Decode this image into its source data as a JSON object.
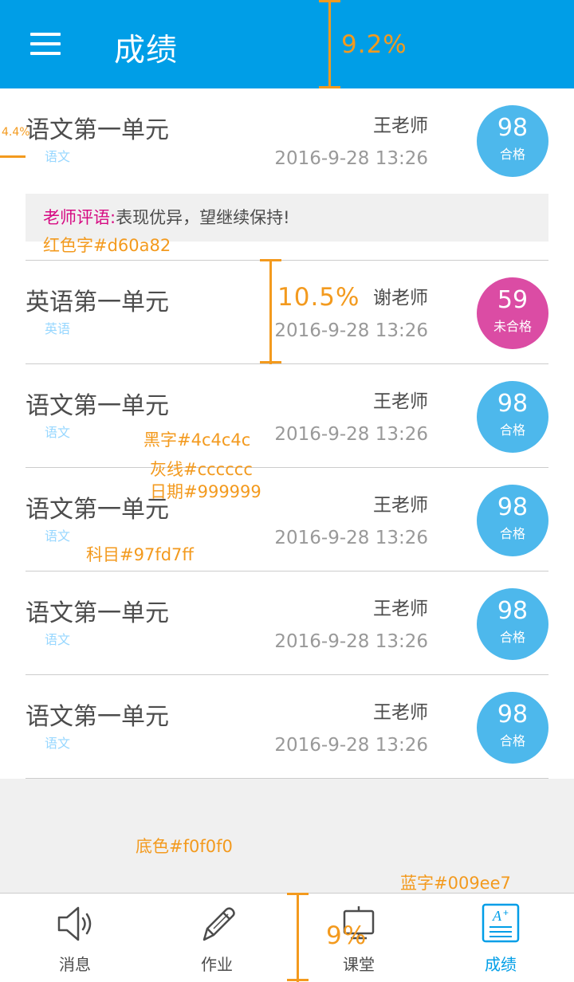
{
  "header": {
    "title": "成绩",
    "menu_icon": "menu-icon"
  },
  "comment_label": "老师评语:",
  "rows": [
    {
      "title": "语文第一单元",
      "subject": "语文",
      "teacher": "王老师",
      "date": "2016-9-28  13:26",
      "score": "98",
      "status": "合格",
      "comment": "表现优异，望继续保持!"
    },
    {
      "title": "英语第一单元",
      "subject": "英语",
      "teacher": "谢老师",
      "date": "2016-9-28  13:26",
      "score": "59",
      "status": "未合格"
    },
    {
      "title": "语文第一单元",
      "subject": "语文",
      "teacher": "王老师",
      "date": "2016-9-28  13:26",
      "score": "98",
      "status": "合格"
    },
    {
      "title": "语文第一单元",
      "subject": "语文",
      "teacher": "王老师",
      "date": "2016-9-28  13:26",
      "score": "98",
      "status": "合格"
    },
    {
      "title": "语文第一单元",
      "subject": "语文",
      "teacher": "王老师",
      "date": "2016-9-28  13:26",
      "score": "98",
      "status": "合格"
    },
    {
      "title": "语文第一单元",
      "subject": "语文",
      "teacher": "王老师",
      "date": "2016-9-28  13:26",
      "score": "98",
      "status": "合格"
    }
  ],
  "annotations": {
    "header_height": "9.2%",
    "margin_left": "4.4%",
    "row_height": "10.5%",
    "tabbar_height": "9%",
    "red_text": "红色字#d60a82",
    "black_text": "黑字#4c4c4c",
    "gray_line": "灰线#cccccc",
    "date_color": "日期#999999",
    "subject_color": "科目#97fd7ff",
    "bg_color": "底色#f0f0f0",
    "blue_text": "蓝字#009ee7"
  },
  "tabs": [
    {
      "label": "消息",
      "icon": "speaker-icon"
    },
    {
      "label": "作业",
      "icon": "pencil-icon"
    },
    {
      "label": "课堂",
      "icon": "classroom-board-icon"
    },
    {
      "label": "成绩",
      "icon": "grade-report-icon",
      "active": true
    }
  ],
  "colors": {
    "primary_blue": "#009ee7",
    "red_text": "#d60a82",
    "black_text": "#4c4c4c",
    "line_gray": "#cccccc",
    "date_gray": "#999999",
    "subject_blue": "#97d7ff",
    "background": "#f0f0f0",
    "pass_circle": "#4db8ec",
    "fail_circle": "#db4ca4",
    "annotation": "#f39a1e"
  }
}
